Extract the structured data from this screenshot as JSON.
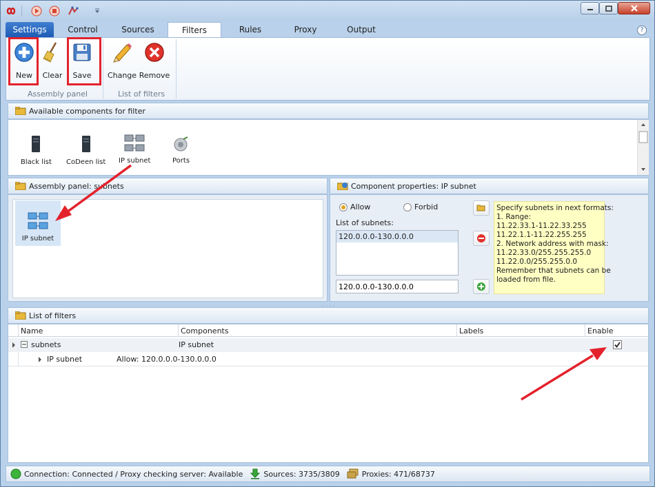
{
  "window": {
    "tabs": [
      "Settings",
      "Control",
      "Sources",
      "Filters",
      "Rules",
      "Proxy",
      "Output"
    ],
    "active_tab": "Filters"
  },
  "ribbon": {
    "new_label": "New",
    "clear_label": "Clear",
    "save_label": "Save",
    "change_label": "Change",
    "remove_label": "Remove",
    "group_assembly": "Assembly panel",
    "group_filters": "List of filters"
  },
  "available": {
    "title": "Available components for filter",
    "items": [
      "Black list",
      "CoDeen list",
      "IP subnet",
      "Ports"
    ]
  },
  "assembly": {
    "title": "Assembly panel: subnets",
    "item": "IP subnet"
  },
  "properties": {
    "title": "Component properties: IP subnet",
    "allow_label": "Allow",
    "forbid_label": "Forbid",
    "list_label": "List of subnets:",
    "list_items": [
      "120.0.0.0-130.0.0.0"
    ],
    "input_value": "120.0.0.0-130.0.0.0",
    "help_text": "Specify subnets in next formats:\n1. Range:\n11.22.33.1-11.22.33.255\n11.22.1.1-11.22.255.255\n2. Network address with mask:\n11.22.33.0/255.255.255.0\n11.22.0.0/255.255.0.0\nRemember that subnets can be\nloaded from file."
  },
  "filters": {
    "title": "List of filters",
    "columns": [
      "Name",
      "Components",
      "Labels",
      "Enable"
    ],
    "row_name": "subnets",
    "row_component": "IP subnet",
    "row_enabled": true,
    "child_name": "IP subnet",
    "child_detail": "Allow: 120.0.0.0-130.0.0.0"
  },
  "status": {
    "connection": "Connection: Connected / Proxy checking server: Available",
    "sources": "Sources: 3735/3809",
    "proxies": "Proxies: 471/68737"
  },
  "colors": {
    "accent": "#1e5bb5",
    "highlight": "#e3222c",
    "note_bg": "#ffffc4"
  }
}
